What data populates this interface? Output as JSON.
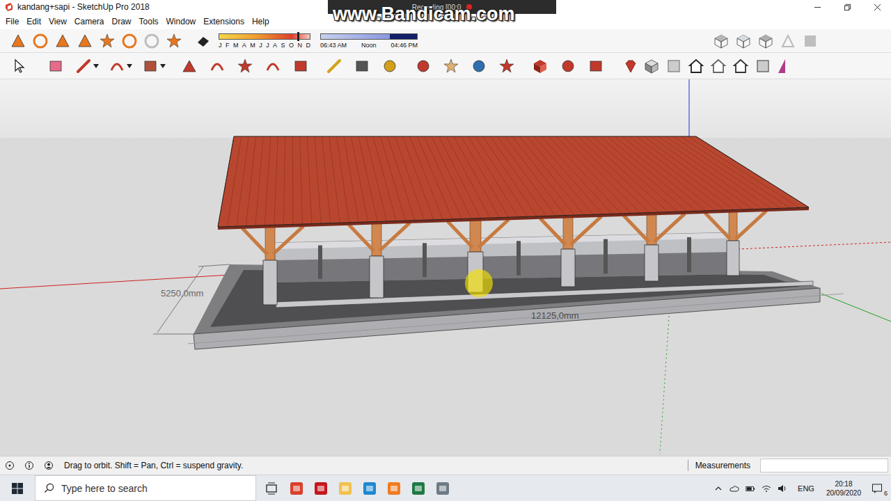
{
  "window": {
    "title": "kandang+sapi - SketchUp Pro 2018"
  },
  "menu": [
    "File",
    "Edit",
    "View",
    "Camera",
    "Draw",
    "Tools",
    "Window",
    "Extensions",
    "Help"
  ],
  "shadow_settings": {
    "months": [
      "J",
      "F",
      "M",
      "A",
      "M",
      "J",
      "J",
      "A",
      "S",
      "O",
      "N",
      "D"
    ],
    "month_level": 0.86,
    "times": [
      "06:43 AM",
      "Noon",
      "04:46 PM"
    ],
    "time_level": 0.72
  },
  "watermark": {
    "text": "www.Bandicam.com",
    "recording": "Recording [00:0"
  },
  "viewport": {
    "dimensions": [
      {
        "label": "5250,0mm"
      },
      {
        "label": "12125,0mm"
      }
    ]
  },
  "status_bar": {
    "hint": "Drag to orbit. Shift = Pan, Ctrl = suspend gravity.",
    "measurements_label": "Measurements",
    "measurements_value": ""
  },
  "taskbar": {
    "search_placeholder": "Type here to search",
    "language": "ENG",
    "time": "20:18",
    "date": "20/09/2020",
    "notifications": "6"
  }
}
